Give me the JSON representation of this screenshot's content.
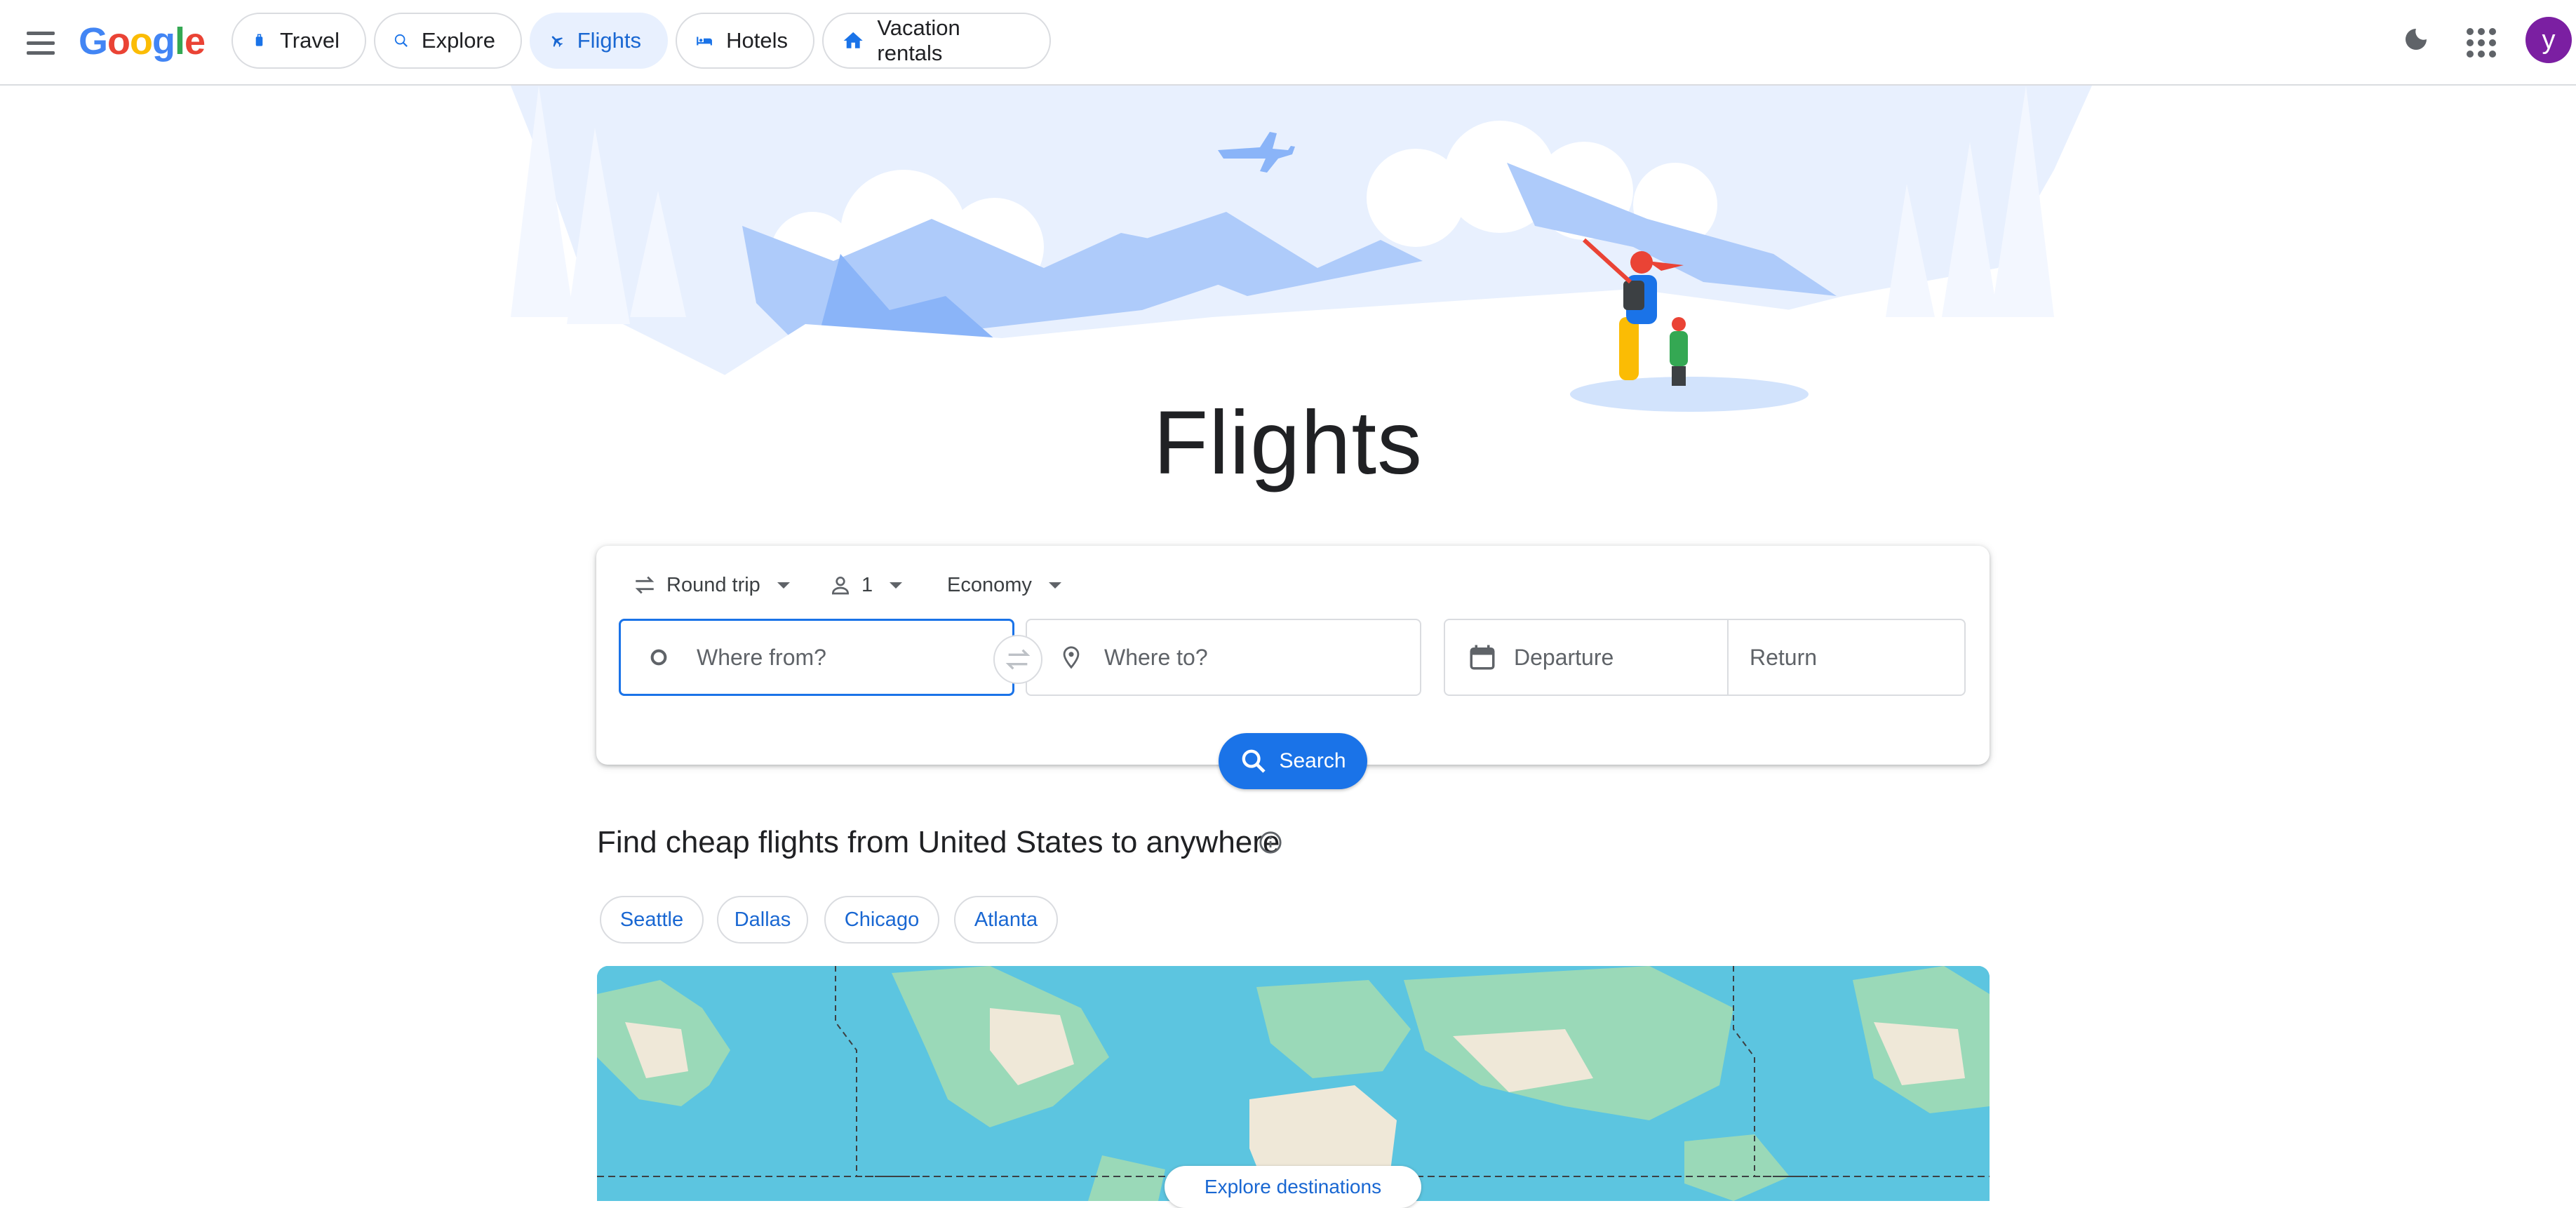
{
  "header": {
    "logo": "Google",
    "nav": [
      {
        "label": "Travel"
      },
      {
        "label": "Explore"
      },
      {
        "label": "Flights"
      },
      {
        "label": "Hotels"
      },
      {
        "label": "Vacation rentals"
      }
    ],
    "avatar_initial": "y"
  },
  "hero": {
    "title": "Flights"
  },
  "search": {
    "trip_type": "Round trip",
    "passengers": "1",
    "cabin_class": "Economy",
    "from_placeholder": "Where from?",
    "to_placeholder": "Where to?",
    "departure_placeholder": "Departure",
    "return_placeholder": "Return",
    "search_label": "Search"
  },
  "cheap_flights": {
    "title": "Find cheap flights from United States to anywhere",
    "cities": [
      "Seattle",
      "Dallas",
      "Chicago",
      "Atlanta"
    ],
    "explore_label": "Explore destinations"
  },
  "colors": {
    "accent": "#1a73e8",
    "active_nav_bg": "#e8f0fe",
    "avatar_bg": "#7b1fa2",
    "map_water": "#5cc5e0",
    "map_land": "#9ad9b8"
  }
}
